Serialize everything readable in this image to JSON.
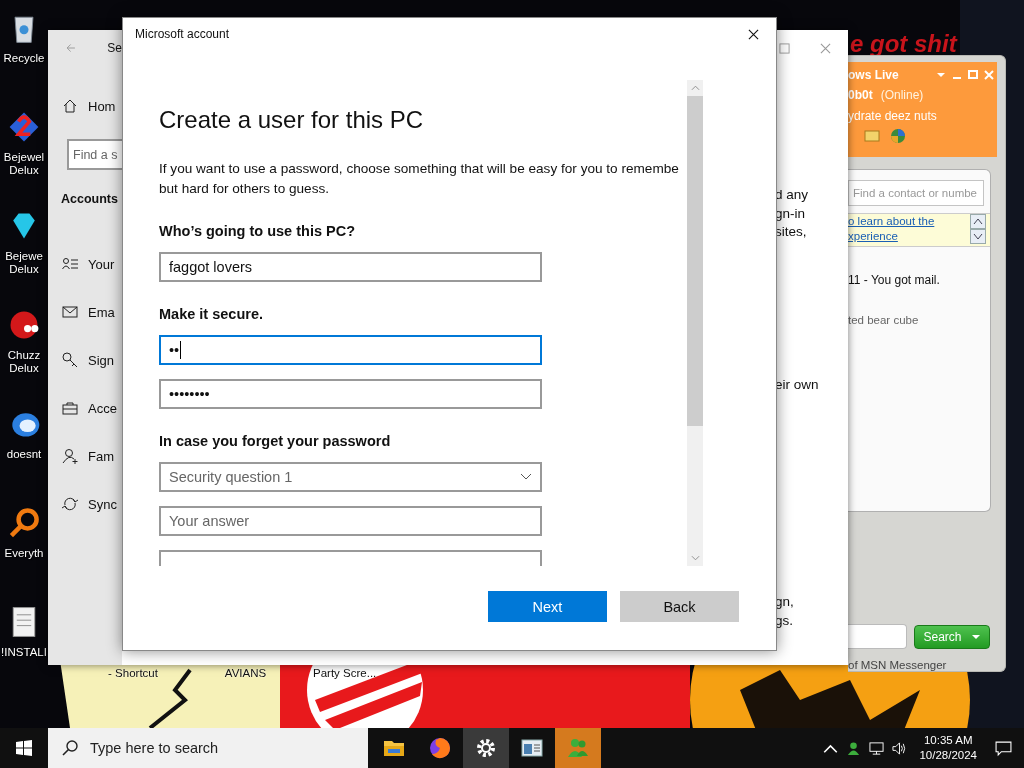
{
  "desktop": {
    "wallpaper_text": "e got shit",
    "icons": [
      {
        "lines": [
          "Recycle"
        ]
      },
      {
        "lines": [
          "Bejewel",
          "Delux"
        ]
      },
      {
        "lines": [
          "Bejewe",
          "Delux"
        ]
      },
      {
        "lines": [
          "Chuzz",
          "Delux"
        ]
      },
      {
        "lines": [
          "doesnt"
        ]
      },
      {
        "lines": [
          "Everyth"
        ]
      },
      {
        "lines": [
          "!INSTALI"
        ]
      }
    ],
    "shortcut_labels": [
      "- Shortcut",
      "AVIANS",
      "Party Scre..."
    ]
  },
  "settings": {
    "title": "Se",
    "nav": {
      "home": "Hom",
      "search_placeholder": "Find a s",
      "section": "Accounts",
      "items": [
        "Your",
        "Ema",
        "Sign",
        "Acce",
        "Fam",
        "Sync"
      ]
    },
    "content_fragments": [
      {
        "lines": [
          "d any",
          "gn-in",
          "sites,"
        ]
      },
      {
        "lines": [
          "eir own"
        ]
      },
      {
        "lines": [
          "gn,",
          "gs."
        ]
      }
    ]
  },
  "dialog": {
    "title": "Microsoft account",
    "heading": "Create a user for this PC",
    "intro": [
      "If you want to use a password, choose something that will be easy for you to remembe",
      "but hard for others to guess."
    ],
    "sections": [
      {
        "label": "Who’s going to use this PC?",
        "fields": [
          {
            "kind": "input",
            "value": "faggot lovers",
            "focused": false
          }
        ]
      },
      {
        "label": "Make it secure.",
        "fields": [
          {
            "kind": "input",
            "value": "••",
            "focused": true
          },
          {
            "kind": "input",
            "value": "••••••••",
            "focused": false
          }
        ]
      },
      {
        "label": "In case you forget your password",
        "fields": [
          {
            "kind": "select",
            "placeholder": "Security question 1",
            "focused": false
          },
          {
            "kind": "input",
            "placeholder": "Your answer",
            "focused": false
          },
          {
            "kind": "input",
            "focused": false
          }
        ]
      }
    ],
    "buttons": [
      {
        "label": "Next",
        "kind": "primary"
      },
      {
        "label": "Back",
        "kind": "secondary"
      }
    ]
  },
  "messenger": {
    "title_fragment": "ows Live",
    "display_name": "0b0t",
    "status": "(Online)",
    "personal_message": "ydrate deez nuts",
    "search_placeholder": "Find a contact or numbe",
    "banner_link": [
      "o learn about the",
      "xperience"
    ],
    "notification": "11 - You got mail.",
    "contact_note": "ted bear cube",
    "search_button": "Search",
    "footer": "of MSN Messenger"
  },
  "taskbar": {
    "search_placeholder": "Type here to search",
    "apps": [
      {
        "selected": false,
        "flashing": false
      },
      {
        "selected": false,
        "flashing": false
      },
      {
        "selected": true,
        "flashing": false
      },
      {
        "selected": false,
        "flashing": false
      },
      {
        "selected": false,
        "flashing": true
      }
    ],
    "time": "10:35 AM",
    "date": "10/28/2024"
  }
}
